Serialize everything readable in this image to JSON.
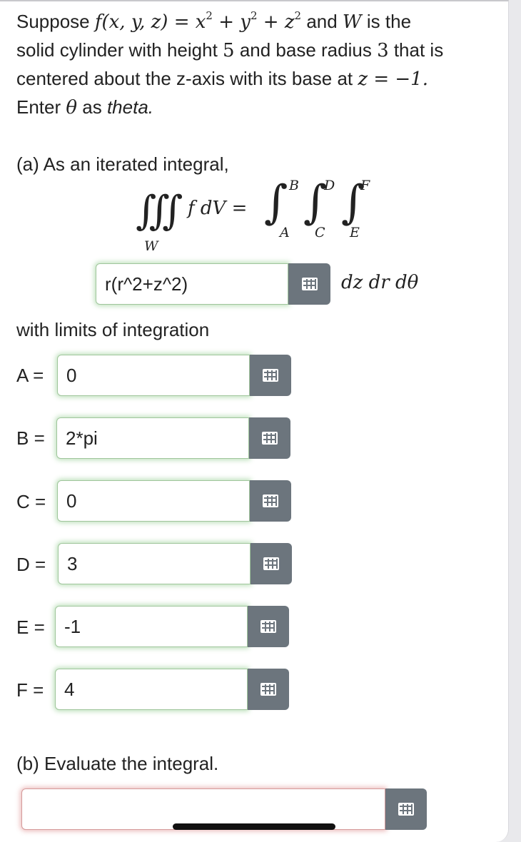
{
  "question": {
    "p1_a": "Suppose ",
    "f_def": "f(x, y, z) = x",
    "sq": "2",
    "plus_y": " + y",
    "plus_z": " + z",
    "and_w": " and ",
    "W": "W",
    "is_the": " is the",
    "line2_a": "solid cylinder with height ",
    "height": "5",
    "line2_b": " and base radius ",
    "radius": "3",
    "line2_c": " that is",
    "line3_a": "centered about the z-axis with its base at ",
    "base_eq": "z = −1.",
    "line4_a": "Enter ",
    "theta_sym": "θ",
    "line4_b": " as ",
    "theta_word": "theta."
  },
  "part_a": {
    "heading": "(a) As an iterated integral,",
    "triple_int": "∭",
    "region": "W",
    "f_dv": "f dV =",
    "int": "∫",
    "limits": {
      "A": "A",
      "B": "B",
      "C": "C",
      "D": "D",
      "E": "E",
      "F": "F"
    },
    "integrand_value": "r(r^2+z^2)",
    "differentials": "dz dr dθ",
    "limits_text": "with limits of integration",
    "fields": [
      {
        "label": "A =",
        "value": "0"
      },
      {
        "label": "B =",
        "value": "2*pi"
      },
      {
        "label": "C =",
        "value": "0"
      },
      {
        "label": "D =",
        "value": "3"
      },
      {
        "label": "E =",
        "value": "-1"
      },
      {
        "label": "F =",
        "value": "4"
      }
    ]
  },
  "part_b": {
    "heading": "(b) Evaluate the integral.",
    "answer_value": ""
  },
  "icons": {
    "keyboard": "grid-keyboard-icon"
  }
}
